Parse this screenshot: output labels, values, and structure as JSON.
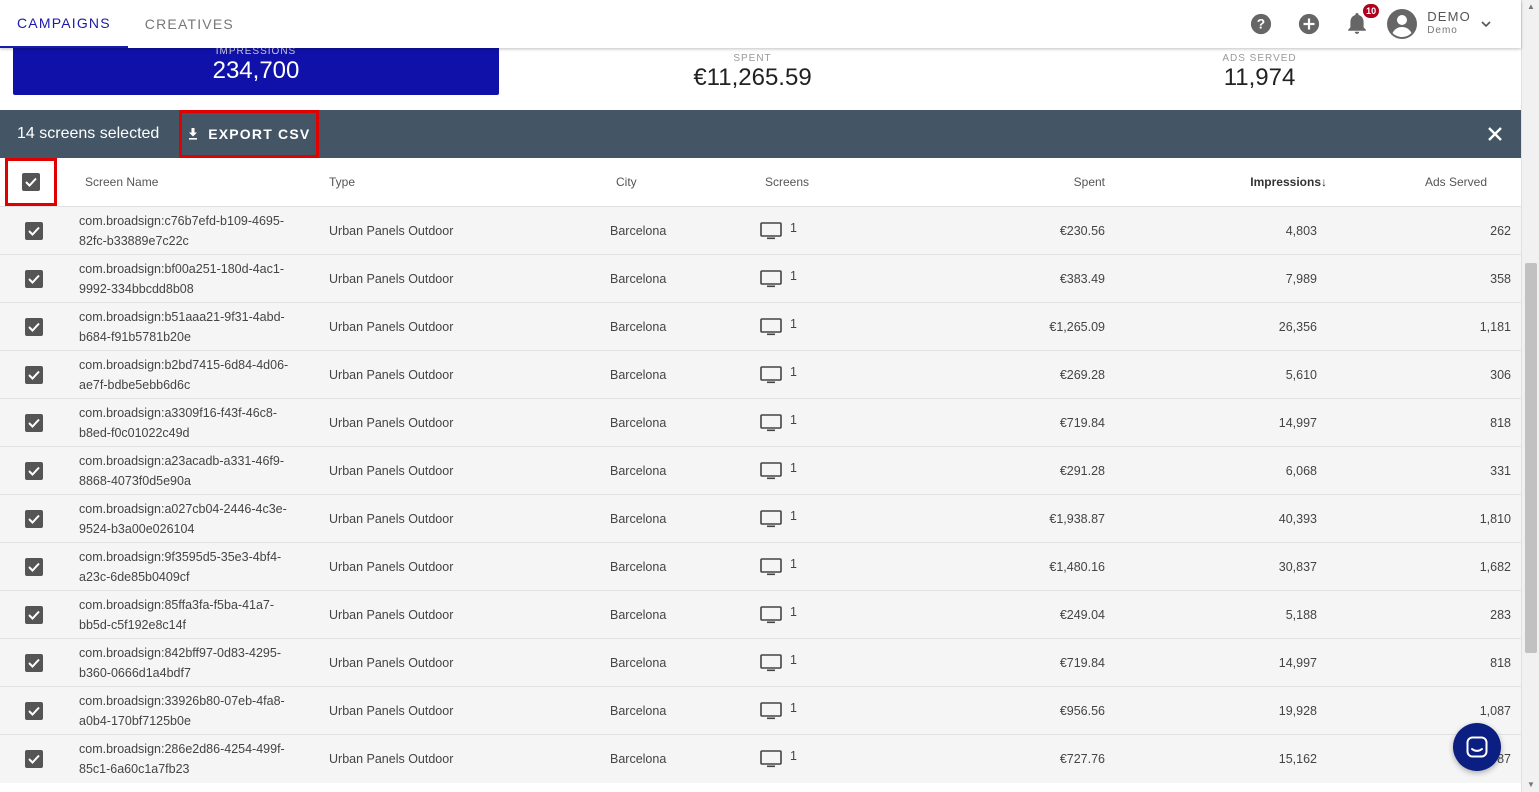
{
  "nav": {
    "tabs": [
      {
        "label": "CAMPAIGNS",
        "active": true
      },
      {
        "label": "CREATIVES",
        "active": false
      }
    ],
    "notification_count": "10",
    "user_name": "DEMO",
    "user_sub": "Demo"
  },
  "stats": [
    {
      "label": "IMPRESSIONS",
      "value": "234,700",
      "highlight": true
    },
    {
      "label": "SPENT",
      "value": "€11,265.59",
      "highlight": false
    },
    {
      "label": "ADS SERVED",
      "value": "11,974",
      "highlight": false
    }
  ],
  "selection": {
    "count_text": "14 screens selected",
    "export_label": "EXPORT CSV"
  },
  "table": {
    "headers": {
      "name": "Screen Name",
      "type": "Type",
      "city": "City",
      "screens": "Screens",
      "spent": "Spent",
      "impressions": "Impressions",
      "ads_served": "Ads Served"
    },
    "sort_indicator": "↓",
    "rows": [
      {
        "name1": "com.broadsign:c76b7efd-b109-4695-",
        "name2": "82fc-b33889e7c22c",
        "type": "Urban Panels Outdoor",
        "city": "Barcelona",
        "screens": "1",
        "spent": "€230.56",
        "impressions": "4,803",
        "ads": "262"
      },
      {
        "name1": "com.broadsign:bf00a251-180d-4ac1-",
        "name2": "9992-334bbcdd8b08",
        "type": "Urban Panels Outdoor",
        "city": "Barcelona",
        "screens": "1",
        "spent": "€383.49",
        "impressions": "7,989",
        "ads": "358"
      },
      {
        "name1": "com.broadsign:b51aaa21-9f31-4abd-",
        "name2": "b684-f91b5781b20e",
        "type": "Urban Panels Outdoor",
        "city": "Barcelona",
        "screens": "1",
        "spent": "€1,265.09",
        "impressions": "26,356",
        "ads": "1,181"
      },
      {
        "name1": "com.broadsign:b2bd7415-6d84-4d06-",
        "name2": "ae7f-bdbe5ebb6d6c",
        "type": "Urban Panels Outdoor",
        "city": "Barcelona",
        "screens": "1",
        "spent": "€269.28",
        "impressions": "5,610",
        "ads": "306"
      },
      {
        "name1": "com.broadsign:a3309f16-f43f-46c8-",
        "name2": "b8ed-f0c01022c49d",
        "type": "Urban Panels Outdoor",
        "city": "Barcelona",
        "screens": "1",
        "spent": "€719.84",
        "impressions": "14,997",
        "ads": "818"
      },
      {
        "name1": "com.broadsign:a23acadb-a331-46f9-",
        "name2": "8868-4073f0d5e90a",
        "type": "Urban Panels Outdoor",
        "city": "Barcelona",
        "screens": "1",
        "spent": "€291.28",
        "impressions": "6,068",
        "ads": "331"
      },
      {
        "name1": "com.broadsign:a027cb04-2446-4c3e-",
        "name2": "9524-b3a00e026104",
        "type": "Urban Panels Outdoor",
        "city": "Barcelona",
        "screens": "1",
        "spent": "€1,938.87",
        "impressions": "40,393",
        "ads": "1,810"
      },
      {
        "name1": "com.broadsign:9f3595d5-35e3-4bf4-",
        "name2": "a23c-6de85b0409cf",
        "type": "Urban Panels Outdoor",
        "city": "Barcelona",
        "screens": "1",
        "spent": "€1,480.16",
        "impressions": "30,837",
        "ads": "1,682"
      },
      {
        "name1": "com.broadsign:85ffa3fa-f5ba-41a7-",
        "name2": "bb5d-c5f192e8c14f",
        "type": "Urban Panels Outdoor",
        "city": "Barcelona",
        "screens": "1",
        "spent": "€249.04",
        "impressions": "5,188",
        "ads": "283"
      },
      {
        "name1": "com.broadsign:842bff97-0d83-4295-",
        "name2": "b360-0666d1a4bdf7",
        "type": "Urban Panels Outdoor",
        "city": "Barcelona",
        "screens": "1",
        "spent": "€719.84",
        "impressions": "14,997",
        "ads": "818"
      },
      {
        "name1": "com.broadsign:33926b80-07eb-4fa8-",
        "name2": "a0b4-170bf7125b0e",
        "type": "Urban Panels Outdoor",
        "city": "Barcelona",
        "screens": "1",
        "spent": "€956.56",
        "impressions": "19,928",
        "ads": "1,087"
      },
      {
        "name1": "com.broadsign:286e2d86-4254-499f-",
        "name2": "85c1-6a60c1a7fb23",
        "type": "Urban Panels Outdoor",
        "city": "Barcelona",
        "screens": "1",
        "spent": "€727.76",
        "impressions": "15,162",
        "ads": "787"
      }
    ]
  },
  "colors": {
    "accent": "#1011a8",
    "selbar": "#445565",
    "highlight_frame": "#e00000",
    "chat": "#0b1e82"
  }
}
